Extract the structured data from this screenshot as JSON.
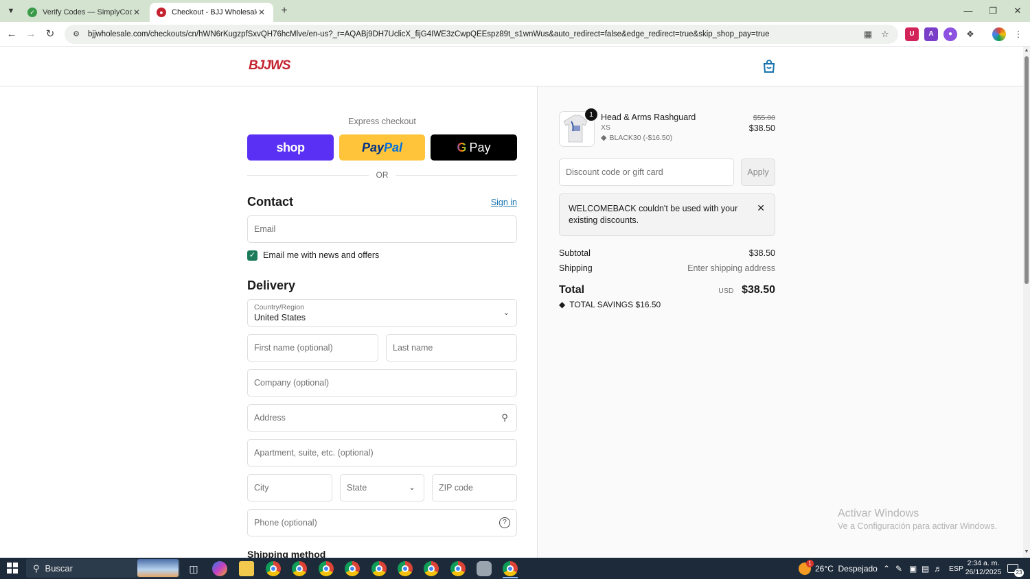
{
  "browser": {
    "tabs": [
      {
        "title": "Verify Codes — SimplyCodes",
        "active": false
      },
      {
        "title": "Checkout - BJJ Wholesale",
        "active": true
      }
    ],
    "url": "bjjwholesale.com/checkouts/cn/hWN6rKugzpfSxvQH76hcMlve/en-us?_r=AQABj9DH7UclicX_fijG4IWE3zCwpQEEspz89t_s1wnWus&auto_redirect=false&edge_redirect=true&skip_shop_pay=true"
  },
  "store": {
    "logo": "BJJWS"
  },
  "express": {
    "label": "Express checkout",
    "shop_label": "shop",
    "paypal_a": "Pay",
    "paypal_b": "Pal",
    "gpay_g": "G",
    "gpay_label": "Pay",
    "or_label": "OR"
  },
  "contact": {
    "title": "Contact",
    "sign_in": "Sign in",
    "email_placeholder": "Email",
    "newsletter_label": "Email me with news and offers",
    "newsletter_checked": true
  },
  "delivery": {
    "title": "Delivery",
    "country_label": "Country/Region",
    "country_value": "United States",
    "first_name": "First name (optional)",
    "last_name": "Last name",
    "company": "Company (optional)",
    "address": "Address",
    "apartment": "Apartment, suite, etc. (optional)",
    "city": "City",
    "state": "State",
    "zip": "ZIP code",
    "phone": "Phone (optional)"
  },
  "shipping_method_title": "Shipping method",
  "order": {
    "item": {
      "quantity": "1",
      "name": "Head & Arms Rashguard",
      "variant": "XS",
      "discount": "BLACK30 (-$16.50)",
      "original_price": "$55.00",
      "price": "$38.50"
    },
    "discount_placeholder": "Discount code or gift card",
    "apply_label": "Apply",
    "error_message": "WELCOMEBACK couldn't be used with your existing discounts.",
    "subtotal_label": "Subtotal",
    "subtotal_value": "$38.50",
    "shipping_label": "Shipping",
    "shipping_value": "Enter shipping address",
    "total_label": "Total",
    "currency": "USD",
    "total_value": "$38.50",
    "savings_label": "TOTAL SAVINGS",
    "savings_value": "$16.50"
  },
  "watermark": {
    "line1": "Activar Windows",
    "line2": "Ve a Configuración para activar Windows."
  },
  "taskbar": {
    "search_label": "Buscar",
    "weather_temp": "26°C",
    "weather_desc": "Despejado",
    "weather_badge": "1",
    "language": "ESP",
    "time": "2:34 a. m.",
    "date": "26/12/2025",
    "notifications": "23"
  },
  "colors": {
    "shop_pay": "#5a31f4",
    "paypal": "#ffc439",
    "link": "#1773b0",
    "checkbox": "#1a7a5a",
    "brand": "#c4232f"
  }
}
